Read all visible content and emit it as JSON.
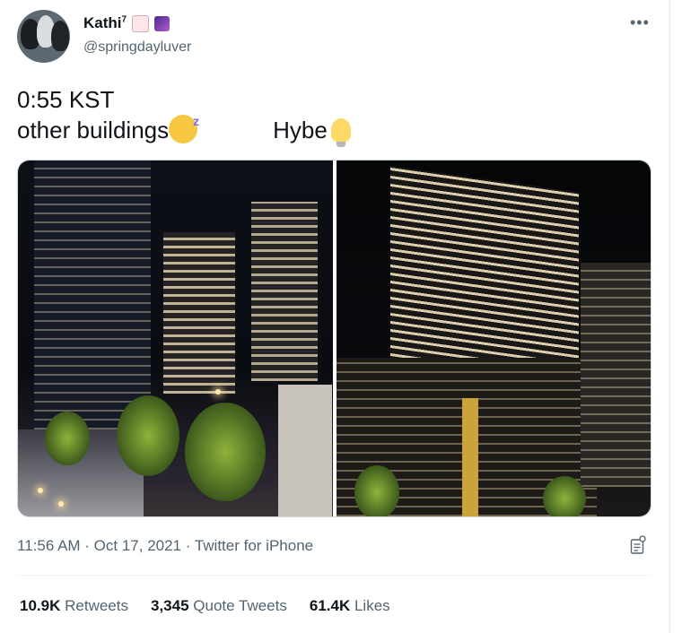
{
  "author": {
    "display_name": "Kathi",
    "display_name_sup": "7",
    "handle": "@springdayluver",
    "name_emojis": [
      "woman-emoji",
      "night-sky-emoji"
    ]
  },
  "tweet": {
    "line1": "0:55 KST",
    "line2_left": "other buildings",
    "line2_right": "Hybe",
    "emojis": [
      "sleeping-face-emoji",
      "light-bulb-emoji"
    ]
  },
  "more_icon": "more-options-icon",
  "timestamp": "11:56 AM · Oct 17, 2021 · Twitter for iPhone",
  "stats": {
    "retweets_count": "10.9K",
    "retweets_label": "Retweets",
    "quotes_count": "3,345",
    "quotes_label": "Quote Tweets",
    "likes_count": "61.4K",
    "likes_label": "Likes"
  },
  "colors": {
    "secondary_text": "#536471",
    "primary_text": "#0f1419",
    "border": "#cfd9de"
  }
}
